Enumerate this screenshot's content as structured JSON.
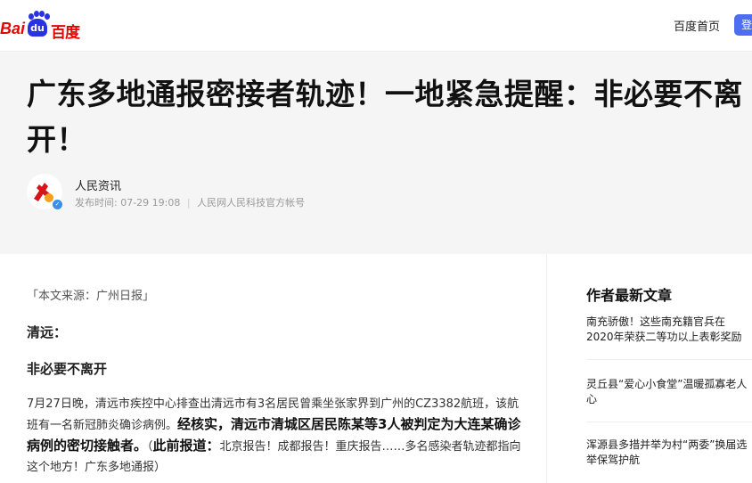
{
  "topbar": {
    "logo_bai": "Bai",
    "logo_du": "du",
    "logo_baidu": "百度",
    "nav_home": "百度首页",
    "login": "登录"
  },
  "article": {
    "title": "广东多地通报密接者轨迹！一地紧急提醒：非必要不离开！",
    "author": {
      "name": "人民资讯",
      "publish_label": "发布时间:",
      "publish_time": "07-29 19:08",
      "account": "人民网人民科技官方帐号"
    },
    "source": "「本文来源：广州日报」",
    "heading_place": "清远：",
    "heading_sub": "非必要不离开",
    "paragraph": {
      "part1": "7月27日晚，清远市疾控中心排查出清远市有3名居民曾乘坐张家界到广州的CZ3382航班，该航班有一名新冠肺炎确诊病例。",
      "bold1": "经核实，清远市清城区居民陈某等3人被判定为大连某确诊病例的密切接触者。",
      "part2": "（",
      "bold2": "此前报道：",
      "part3": "北京报告！成都报告！重庆报告……多名感染者轨迹都指向这个地方！广东多地通报）"
    }
  },
  "sidebar": {
    "title": "作者最新文章",
    "items": [
      "南充骄傲！这些南充籍官兵在2020年荣获二等功以上表彰奖励",
      "灵丘县“爱心小食堂”温暖孤寡老人心",
      "浑源县多措并举为村“两委”换届选举保驾护航"
    ]
  },
  "colors": {
    "brand_red": "#e10602",
    "brand_blue": "#2932e1",
    "login_blue": "#4e6ef2",
    "header_bg": "#f5f5f6"
  }
}
